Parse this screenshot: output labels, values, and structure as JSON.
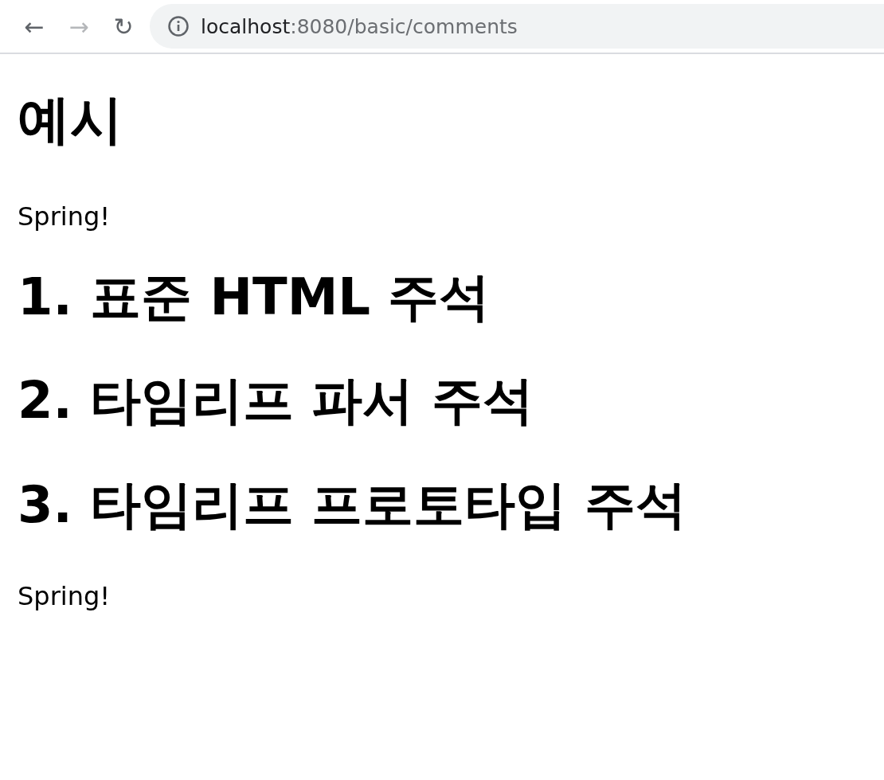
{
  "browser": {
    "back": {
      "label": "←",
      "disabled": false
    },
    "forward": {
      "label": "→",
      "disabled": true
    },
    "reload": {
      "label": "↻",
      "disabled": false
    },
    "address": {
      "host": "localhost",
      "path": ":8080/basic/comments"
    }
  },
  "content": [
    {
      "kind": "title",
      "text": "예시"
    },
    {
      "kind": "paragraph",
      "text": "Spring!"
    },
    {
      "kind": "heading",
      "text": "1. 표준 HTML 주석"
    },
    {
      "kind": "heading",
      "text": "2. 타임리프 파서 주석"
    },
    {
      "kind": "heading",
      "text": "3. 타임리프 프로토타입 주석"
    },
    {
      "kind": "paragraph",
      "text": "Spring!"
    }
  ]
}
